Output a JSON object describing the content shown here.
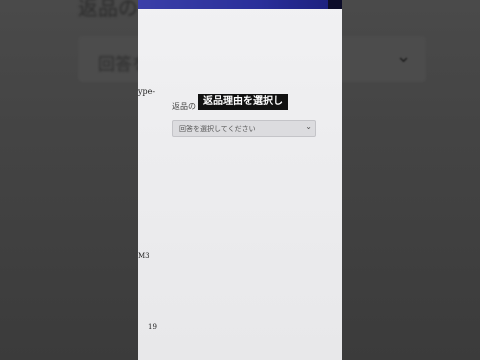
{
  "background": {
    "title_partial": "返品の",
    "select_partial": "回答を",
    "chevron_icon": "chevron-down-icon"
  },
  "phone": {
    "topbar_color": "#2a2f9a",
    "side_fragments": {
      "pe": "ype-",
      "m3": "M3",
      "n19": "19"
    },
    "field_label_partial": "返品の",
    "select": {
      "value": "回答を選択してください",
      "chevron_icon": "chevron-down-icon"
    }
  },
  "caption": {
    "text": "返品理由を選択し"
  }
}
